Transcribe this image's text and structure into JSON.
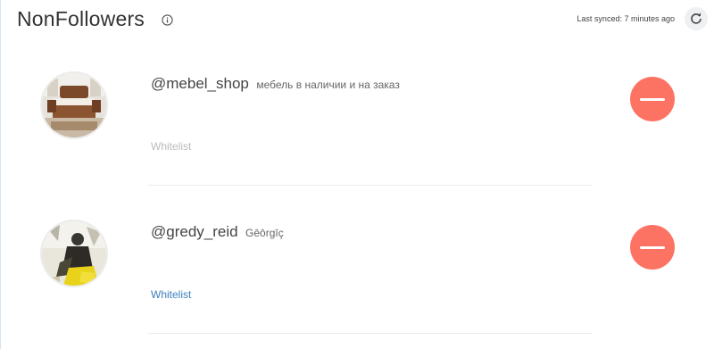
{
  "header": {
    "title": "NonFollowers",
    "info_icon": "info-circle-icon",
    "sync_status": "Last synced: 7 minutes ago",
    "refresh_icon": "refresh-icon"
  },
  "users": [
    {
      "username": "@mebel_shop",
      "full_name": "мебель в наличии и на заказ",
      "whitelist_label": "Whitelist",
      "whitelist_state": "disabled",
      "remove_icon": "minus-icon"
    },
    {
      "username": "@gredy_reid",
      "full_name": "Gēōrgīç",
      "whitelist_label": "Whitelist",
      "whitelist_state": "enabled",
      "remove_icon": "minus-icon"
    }
  ],
  "colors": {
    "remove_button": "#fd7363",
    "whitelist_active": "#3c7fbe",
    "whitelist_inactive": "#bbbbbb"
  }
}
